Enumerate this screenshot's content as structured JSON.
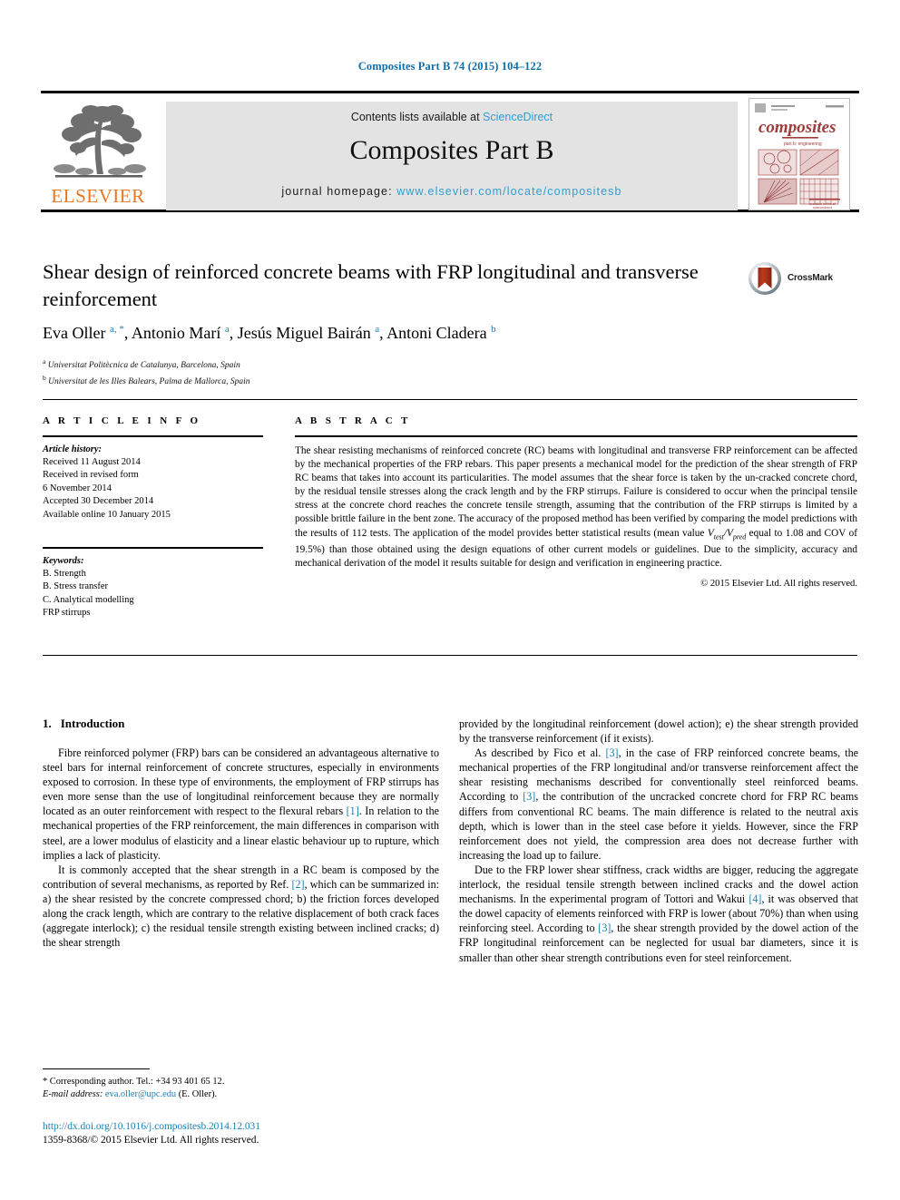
{
  "running_head": "Composites Part B 74 (2015) 104–122",
  "banner": {
    "publisher_name": "ELSEVIER",
    "contents_prefix": "Contents lists available at ",
    "contents_link": "ScienceDirect",
    "journal_name": "Composites Part B",
    "homepage_prefix": "journal homepage: ",
    "homepage_url": "www.elsevier.com/locate/compositesb",
    "cover_title": "composites",
    "cover_subtitle": "part b: engineering"
  },
  "article": {
    "title": "Shear design of reinforced concrete beams with FRP longitudinal and transverse reinforcement",
    "crossmark_label": "CrossMark",
    "authors": [
      {
        "name": "Eva Oller",
        "marks": "a, *"
      },
      {
        "name": "Antonio Marí",
        "marks": "a"
      },
      {
        "name": "Jesús Miguel Bairán",
        "marks": "a"
      },
      {
        "name": "Antoni Cladera",
        "marks": "b"
      }
    ],
    "affiliations": [
      {
        "mark": "a",
        "text": "Universitat Politècnica de Catalunya, Barcelona, Spain"
      },
      {
        "mark": "b",
        "text": "Universitat de les Illes Balears, Palma de Mallorca, Spain"
      }
    ]
  },
  "info": {
    "heading": "A R T I C L E   I N F O",
    "history_label": "Article history:",
    "history": [
      "Received 11 August 2014",
      "Received in revised form",
      "6 November 2014",
      "Accepted 30 December 2014",
      "Available online 10 January 2015"
    ],
    "keywords_label": "Keywords:",
    "keywords": [
      "B. Strength",
      "B. Stress transfer",
      "C. Analytical modelling",
      "FRP stirrups"
    ]
  },
  "abstract": {
    "heading": "A B S T R A C T",
    "text_part1": "The shear resisting mechanisms of reinforced concrete (RC) beams with longitudinal and transverse FRP reinforcement can be affected by the mechanical properties of the FRP rebars. This paper presents a mechanical model for the prediction of the shear strength of FRP RC beams that takes into account its particularities. The model assumes that the shear force is taken by the un-cracked concrete chord, by the residual tensile stresses along the crack length and by the FRP stirrups. Failure is considered to occur when the principal tensile stress at the concrete chord reaches the concrete tensile strength, assuming that the contribution of the FRP stirrups is limited by a possible brittle failure in the bent zone. The accuracy of the proposed method has been verified by comparing the model predictions with the results of 112 tests. The application of the model provides better statistical results (mean value ",
    "ratio_numerator": "V",
    "ratio_num_sub": "test",
    "ratio_denominator": "V",
    "ratio_den_sub": "pred",
    "text_part2": " equal to 1.08 and COV of 19.5%) than those obtained using the design equations of other current models or guidelines. Due to the simplicity, accuracy and mechanical derivation of the model it results suitable for design and verification in engineering practice.",
    "copyright": "© 2015 Elsevier Ltd. All rights reserved."
  },
  "section": {
    "number": "1.",
    "title": "Introduction"
  },
  "body": {
    "left": [
      {
        "parts": [
          {
            "t": "Fibre reinforced polymer (FRP) bars can be considered an advantageous alternative to steel bars for internal reinforcement of concrete structures, especially in environments exposed to corrosion. In these type of environments, the employment of FRP stirrups has even more sense than the use of longitudinal reinforcement because they are normally located as an outer reinforcement with respect to the flexural rebars "
          },
          {
            "t": "[1]",
            "ref": true
          },
          {
            "t": ". In relation to the mechanical properties of the FRP reinforcement, the main differences in comparison with steel, are a lower modulus of elasticity and a linear elastic behaviour up to rupture, which implies a lack of plasticity."
          }
        ]
      },
      {
        "parts": [
          {
            "t": "It is commonly accepted that the shear strength in a RC beam is composed by the contribution of several mechanisms, as reported by Ref. "
          },
          {
            "t": "[2]",
            "ref": true
          },
          {
            "t": ", which can be summarized in: a) the shear resisted by the concrete compressed chord; b) the friction forces developed along the crack length, which are contrary to the relative displacement of both crack faces (aggregate interlock); c) the residual tensile strength existing between inclined cracks; d) the shear strength"
          }
        ]
      }
    ],
    "right": [
      {
        "noindent": true,
        "parts": [
          {
            "t": "provided by the longitudinal reinforcement (dowel action); e) the shear strength provided by the transverse reinforcement (if it exists)."
          }
        ]
      },
      {
        "parts": [
          {
            "t": "As described by Fico et al. "
          },
          {
            "t": "[3]",
            "ref": true
          },
          {
            "t": ", in the case of FRP reinforced concrete beams, the mechanical properties of the FRP longitudinal and/or transverse reinforcement affect the shear resisting mechanisms described for conventionally steel reinforced beams. According to "
          },
          {
            "t": "[3]",
            "ref": true
          },
          {
            "t": ", the contribution of the uncracked concrete chord for FRP RC beams differs from conventional RC beams. The main difference is related to the neutral axis depth, which is lower than in the steel case before it yields. However, since the FRP reinforcement does not yield, the compression area does not decrease further with increasing the load up to failure."
          }
        ]
      },
      {
        "parts": [
          {
            "t": "Due to the FRP lower shear stiffness, crack widths are bigger, reducing the aggregate interlock, the residual tensile strength between inclined cracks and the dowel action mechanisms. In the experimental program of Tottori and Wakui "
          },
          {
            "t": "[4]",
            "ref": true
          },
          {
            "t": ", it was observed that the dowel capacity of elements reinforced with FRP is lower (about 70%) than when using reinforcing steel. According to "
          },
          {
            "t": "[3]",
            "ref": true
          },
          {
            "t": ", the shear strength provided by the dowel action of the FRP longitudinal reinforcement can be neglected for usual bar diameters, since it is smaller than other shear strength contributions even for steel reinforcement."
          }
        ]
      }
    ]
  },
  "footnote": {
    "corresponding": "* Corresponding author. Tel.: +34 93 401 65 12.",
    "email_label": "E-mail address:",
    "email": "eva.oller@upc.edu",
    "email_suffix": " (E. Oller)."
  },
  "footer": {
    "doi": "http://dx.doi.org/10.1016/j.compositesb.2014.12.031",
    "issn": "1359-8368/© 2015 Elsevier Ltd. All rights reserved."
  },
  "colors": {
    "link_blue": "#2e9fd4",
    "ref_blue": "#1a7fb3",
    "head_blue": "#0f6fa8",
    "elsevier_orange": "#E87722",
    "cover_red": "#9e3b3b"
  }
}
